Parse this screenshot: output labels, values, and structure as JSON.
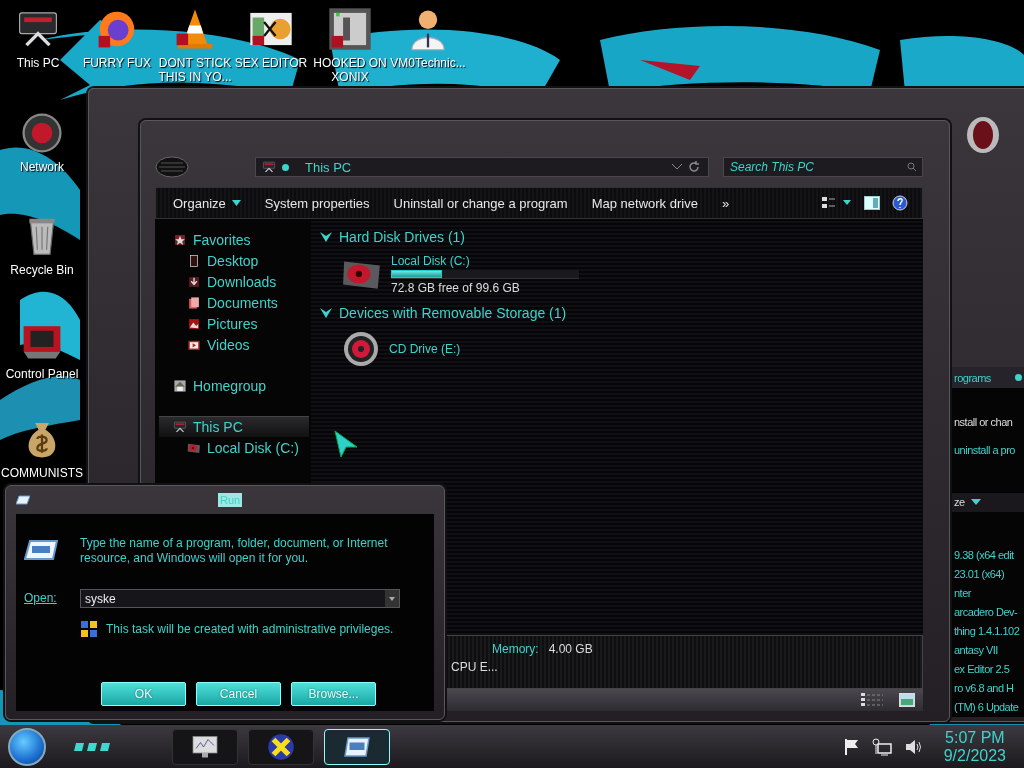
{
  "desktop_icons": [
    {
      "kind": "computer",
      "label": "This PC"
    },
    {
      "kind": "browser",
      "label": "FURRY FUX"
    },
    {
      "kind": "cone",
      "label": "DONT STICK THIS IN YO..."
    },
    {
      "kind": "editor",
      "label": "SEX EDITOR"
    },
    {
      "kind": "game",
      "label": "HOOKED ON XONIX"
    },
    {
      "kind": "person",
      "label": "VM0Technic..."
    },
    {
      "kind": "globe",
      "label": "Network"
    },
    {
      "kind": "bin",
      "label": "Recycle Bin"
    },
    {
      "kind": "panel",
      "label": "Control Panel"
    },
    {
      "kind": "money",
      "label": "COMMUNISTS"
    }
  ],
  "back_window": {
    "header": "rograms",
    "lines": [
      "nstall or chan",
      "uninstall a pro"
    ],
    "toolbar": "ze",
    "programs": [
      "9.38 (x64 edit",
      "23.01 (x64)",
      "nter",
      "arcadero Dev-",
      "thing 1.4.1.102",
      "antasy VII",
      "ex Editor 2.5",
      "ro v6.8 and H",
      "(TM) 6 Update"
    ]
  },
  "explorer": {
    "address": "This PC",
    "search": {
      "placeholder": "Search This PC"
    },
    "toolbar": [
      {
        "label": "Organize",
        "dropdown": true
      },
      {
        "label": "System properties",
        "dropdown": false
      },
      {
        "label": "Uninstall or change a program",
        "dropdown": false
      },
      {
        "label": "Map network drive",
        "dropdown": false
      },
      {
        "label": "»",
        "dropdown": false
      }
    ],
    "nav": [
      {
        "kind": "star",
        "label": "Favorites",
        "selected": false,
        "children": [
          {
            "kind": "desktop",
            "label": "Desktop",
            "selected": false
          },
          {
            "kind": "download",
            "label": "Downloads",
            "selected": false
          },
          {
            "kind": "docs",
            "label": "Documents",
            "selected": false
          },
          {
            "kind": "pics",
            "label": "Pictures",
            "selected": false
          },
          {
            "kind": "video",
            "label": "Videos",
            "selected": false
          }
        ]
      },
      {
        "kind": "home",
        "label": "Homegroup",
        "selected": false
      },
      {
        "kind": "pc",
        "label": "This PC",
        "selected": true,
        "children": [
          {
            "kind": "disk",
            "label": "Local Disk (C:)",
            "selected": false
          }
        ]
      }
    ],
    "groups": [
      {
        "title": "Hard Disk Drives (1)",
        "items": [
          {
            "kind": "disk",
            "name": "Local Disk (C:)",
            "level": 0.27,
            "free": "72.8 GB free of 99.6 GB"
          }
        ]
      },
      {
        "title": "Devices with Removable Storage (1)",
        "items": [
          {
            "kind": "cd",
            "name": "CD Drive (E:)"
          }
        ]
      }
    ],
    "details": {
      "memory_label": "Memory:",
      "memory": "4.00 GB",
      "cpu": "CPU E..."
    }
  },
  "run": {
    "title": "Run",
    "message": "Type the name of a program, folder, document, or Internet resource, and Windows will open it for you.",
    "open_label": "Open:",
    "value": "syske",
    "admin_note": "This task will be created with administrative privileges.",
    "buttons": [
      "OK",
      "Cancel",
      "Browse..."
    ]
  },
  "taskbar": {
    "items": [
      {
        "kind": "monitor",
        "selected": false
      },
      {
        "kind": "xapp",
        "selected": false
      },
      {
        "kind": "run",
        "selected": true
      }
    ],
    "time": "5:07 PM",
    "date": "9/2/2023"
  }
}
